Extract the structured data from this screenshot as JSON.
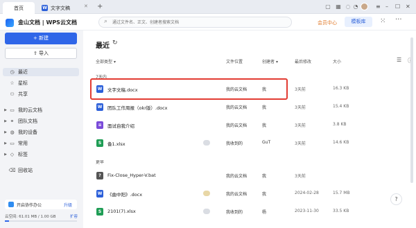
{
  "tabs": [
    {
      "label": "首页"
    },
    {
      "label": "文字文稿"
    }
  ],
  "colors": {
    "accent": "#2f66e8",
    "highlight_box": "#e23b32",
    "member": "#e07a2a",
    "word": "#2b5fd9",
    "excel": "#1f9d55",
    "script": "#7a4bd9",
    "bat": "#555555"
  },
  "app": {
    "title": "金山文档 | WPS云文档"
  },
  "search": {
    "placeholder": "通过文件名、正文、创建者搜索文档"
  },
  "header": {
    "member": "会员中心",
    "templates": "模板库"
  },
  "sidebar": {
    "new_button": "+ 新建",
    "import_button": "导入",
    "items": [
      {
        "label": "最近",
        "icon": "clock-icon",
        "active": true
      },
      {
        "label": "星标",
        "icon": "star-icon"
      },
      {
        "label": "共享",
        "icon": "share-icon"
      },
      {
        "label": "我的云文档",
        "icon": "folder-icon",
        "expandable": true
      },
      {
        "label": "团队文档",
        "icon": "team-icon",
        "expandable": true
      },
      {
        "label": "我的设备",
        "icon": "device-icon",
        "expandable": true
      },
      {
        "label": "常用",
        "icon": "folder-icon",
        "expandable": true
      },
      {
        "label": "标签",
        "icon": "tag-icon",
        "expandable": true
      },
      {
        "label": "回收站",
        "icon": "trash-icon"
      }
    ],
    "collab": {
      "label": "开启协作办公",
      "upgrade": "升级"
    },
    "storage": {
      "text": "云空间: 61.01 MB / 1.00 GB",
      "expand": "扩容",
      "used_fraction": 0.06
    }
  },
  "main": {
    "title": "最近",
    "columns": {
      "type": "全部类型",
      "location": "文件位置",
      "creator": "创建者",
      "modified": "最后修改",
      "size": "大小"
    },
    "groups": [
      {
        "label": "7天内",
        "files": [
          {
            "name": "文字文稿.docx",
            "type": "word",
            "location": "我的云文档",
            "creator": "我",
            "modified": "3天前",
            "size": "16.3 KB",
            "collab": false
          },
          {
            "name": "团队工作周报（okr版）.docx",
            "type": "word",
            "location": "我的云文档",
            "creator": "我",
            "modified": "3天前",
            "size": "15.4 KB",
            "collab": false
          },
          {
            "name": "面试自我介绍",
            "type": "script",
            "location": "我的云文档",
            "creator": "我",
            "modified": "3天前",
            "size": "3.8 KB",
            "collab": false
          },
          {
            "name": "备1.xlsx",
            "type": "excel",
            "location": "我收到的",
            "creator": "GuT",
            "modified": "3天前",
            "size": "14.6 KB",
            "collab": true
          }
        ]
      },
      {
        "label": "更早",
        "files": [
          {
            "name": "Fix-Close_Hyper-V.bat",
            "type": "bat",
            "location": "我的云文档",
            "creator": "我",
            "modified": "3天前",
            "size": "",
            "collab": false
          },
          {
            "name": "《曲中阳》.docx",
            "type": "word",
            "location": "我的云文档",
            "creator": "我",
            "modified": "2024-02-28",
            "size": "15.7 MB",
            "collab": true
          },
          {
            "name": "2101(7).xlsx",
            "type": "excel",
            "location": "我收到的",
            "creator": "杨",
            "modified": "2023-11-30",
            "size": "33.5 KB",
            "collab": true
          }
        ]
      }
    ]
  }
}
